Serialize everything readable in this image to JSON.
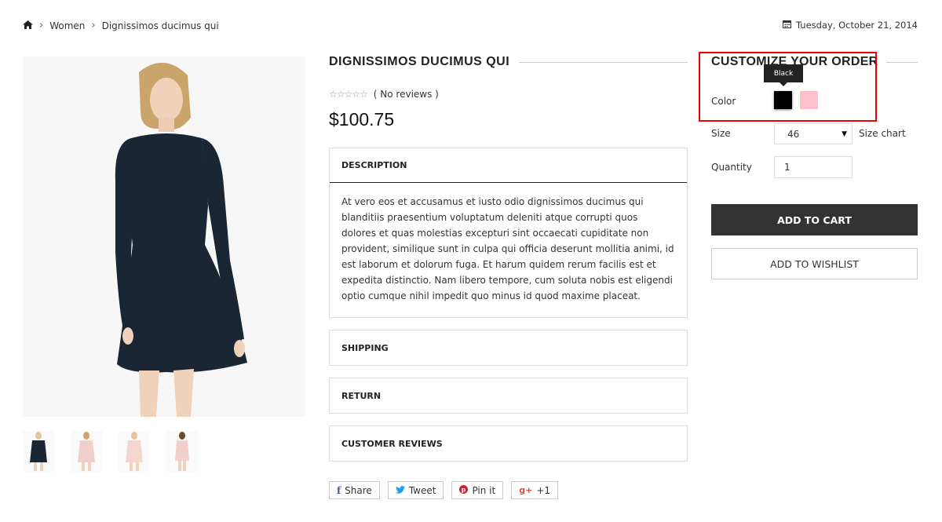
{
  "breadcrumb": {
    "category": "Women",
    "current": "Dignissimos ducimus qui"
  },
  "date": "Tuesday, October 21, 2014",
  "product": {
    "title": "DIGNISSIMOS DUCIMUS QUI",
    "reviews_text": "( No reviews )",
    "rating": 0,
    "price": "$100.75"
  },
  "panels": {
    "description": {
      "title": "DESCRIPTION",
      "body": "At vero eos et accusamus et iusto odio dignissimos ducimus qui blanditiis praesentium voluptatum deleniti atque corrupti quos dolores et quas molestias excepturi sint occaecati cupiditate non provident, similique sunt in culpa qui officia deserunt mollitia animi, id est laborum et dolorum fuga. Et harum quidem rerum facilis est et expedita distinctio. Nam libero tempore, cum soluta nobis est eligendi optio cumque nihil impedit quo minus id quod maxime placeat."
    },
    "shipping": {
      "title": "SHIPPING"
    },
    "return": {
      "title": "RETURN"
    },
    "reviews": {
      "title": "CUSTOMER REVIEWS"
    }
  },
  "social": {
    "share": "Share",
    "tweet": "Tweet",
    "pin": "Pin it",
    "plus": "+1",
    "gplus_icon": "g+"
  },
  "customize": {
    "title": "CUSTOMIZE YOUR ORDER",
    "color_label": "Color",
    "tooltip": "Black",
    "colors": [
      {
        "name": "Black",
        "hex": "#000000"
      },
      {
        "name": "Pink",
        "hex": "#ffc0cb"
      }
    ],
    "size_label": "Size",
    "size_value": "46",
    "size_chart": "Size chart",
    "quantity_label": "Quantity",
    "quantity_value": "1",
    "add_to_cart": "ADD TO CART",
    "add_to_wishlist": "ADD TO WISHLIST"
  },
  "icons": [
    "home-icon",
    "chevron-right-icon",
    "calendar-icon",
    "star-icon",
    "facebook-icon",
    "twitter-icon",
    "pinterest-icon",
    "google-plus-icon",
    "caret-down-icon"
  ],
  "colors": {
    "highlight": "#ee0000",
    "button_dark": "#333333"
  }
}
